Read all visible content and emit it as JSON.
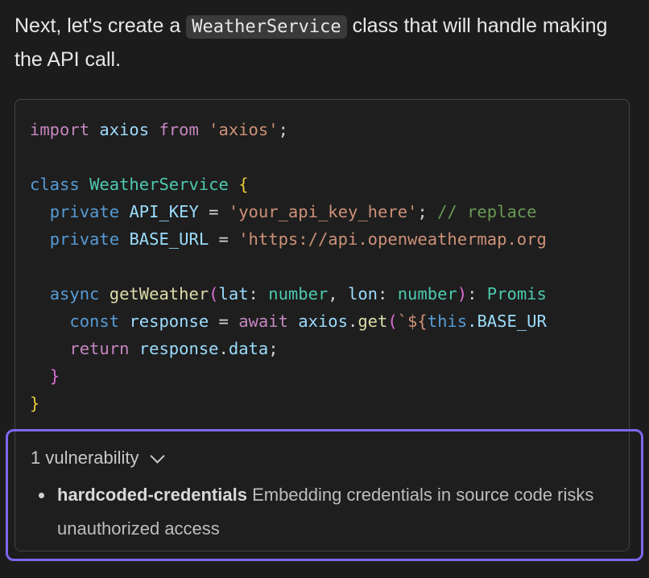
{
  "intro": {
    "before": "Next, let's create a ",
    "code": "WeatherService",
    "after": " class that will handle making the API call."
  },
  "code": {
    "lines": [
      [
        "import",
        " axios ",
        "from",
        " 'axios'",
        ";"
      ],
      [],
      [
        "class",
        " ",
        "WeatherService",
        " ",
        "{"
      ],
      [
        "  ",
        "private",
        " ",
        "API_KEY",
        " = ",
        "'your_api_key_here'",
        "; ",
        "// replace"
      ],
      [
        "  ",
        "private",
        " ",
        "BASE_URL",
        " = ",
        "'https://api.openweathermap.org"
      ],
      [],
      [
        "  ",
        "async",
        " ",
        "getWeather",
        "(",
        "lat",
        ": ",
        "number",
        ", ",
        "lon",
        ": ",
        "number",
        ")",
        ": ",
        "Promis"
      ],
      [
        "    ",
        "const",
        " ",
        "response",
        " = ",
        "await",
        " ",
        "axios",
        ".",
        "get",
        "(",
        "`${",
        "this",
        ".BASE_UR"
      ],
      [
        "    ",
        "return",
        " ",
        "response",
        ".",
        "data",
        ";"
      ],
      [
        "  ",
        "}"
      ],
      [
        "}"
      ]
    ]
  },
  "vulnerabilities": {
    "summary": "1 vulnerability",
    "items": [
      {
        "name": "hardcoded-credentials",
        "description": " Embedding credentials in source code risks unauthorized access"
      }
    ]
  },
  "colors": {
    "accent_border": "#7b68ee",
    "background": "#1c1c1c"
  }
}
